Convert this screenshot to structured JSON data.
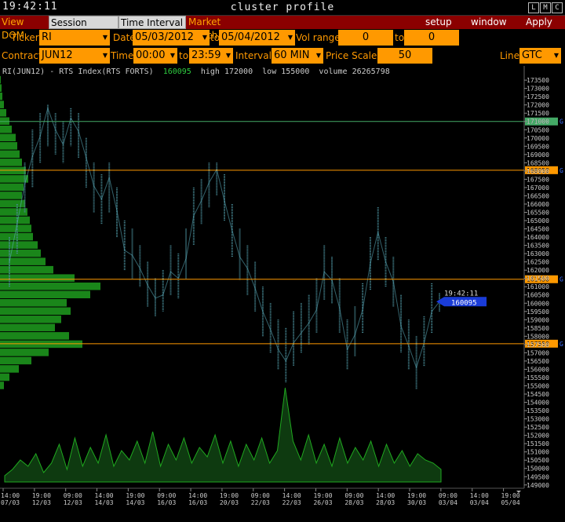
{
  "window": {
    "clock": "19:42:11",
    "title": "cluster profile",
    "buttons": [
      "L",
      "M",
      "C"
    ]
  },
  "menubar": {
    "view_dom": "View DOM",
    "session_hours": "Session Hours",
    "time_interval": "Time Interval",
    "market_watch": "Market Watch",
    "setup": "setup",
    "window": "window",
    "apply": "Apply"
  },
  "controls": {
    "ticker_label": "Ticker",
    "ticker": "RI",
    "date_label": "Date",
    "date_from": "05/03/2012",
    "to_label": "to",
    "date_to": "05/04/2012",
    "vol_range_label": "Vol range",
    "vol_from": "0",
    "vol_to": "0",
    "contract_label": "Contract",
    "contract": "JUN12",
    "time_label": "Time",
    "time_from": "00:00",
    "time_to": "23:59",
    "interval_label": "Interval",
    "interval": "60 MIN",
    "price_scale_label": "Price Scale",
    "price_scale": "50",
    "line_label": "Line",
    "line": "GTC"
  },
  "info": {
    "instrument": "RI(JUN12) - RTS Index(RTS FORTS)",
    "last": "160095",
    "high": "high 172000",
    "low": "low 155000",
    "volume": "volume 26265798"
  },
  "chart_data": {
    "type": "line",
    "y_range": [
      148800,
      173600
    ],
    "y_step": 500,
    "y_ticks_first": 149000,
    "y_ticks_last": 173500,
    "levels": [
      {
        "value": 171000,
        "label": "171000",
        "color": "#44aa66",
        "marker": "G"
      },
      {
        "value": 168050,
        "label": "168050",
        "color": "#ff9900",
        "marker": "G"
      },
      {
        "value": 161450,
        "label": "161450",
        "color": "#ff9900",
        "marker": "G"
      },
      {
        "value": 157550,
        "label": "157550",
        "color": "#ff9900",
        "marker": "G"
      }
    ],
    "current": {
      "time": "19:42:11",
      "value": 160095
    },
    "x_ticks": [
      {
        "t": "14:00",
        "d": "07/03"
      },
      {
        "t": "19:00",
        "d": "12/03"
      },
      {
        "t": "09:00",
        "d": "12/03"
      },
      {
        "t": "14:00",
        "d": "14/03"
      },
      {
        "t": "19:00",
        "d": "14/03"
      },
      {
        "t": "09:00",
        "d": "16/03"
      },
      {
        "t": "14:00",
        "d": "16/03"
      },
      {
        "t": "19:00",
        "d": "20/03"
      },
      {
        "t": "09:00",
        "d": "22/03"
      },
      {
        "t": "14:00",
        "d": "22/03"
      },
      {
        "t": "19:00",
        "d": "26/03"
      },
      {
        "t": "09:00",
        "d": "28/03"
      },
      {
        "t": "14:00",
        "d": "28/03"
      },
      {
        "t": "19:00",
        "d": "30/03"
      },
      {
        "t": "09:00",
        "d": "03/04"
      },
      {
        "t": "14:00",
        "d": "03/04"
      },
      {
        "t": "19:00",
        "d": "05/04"
      }
    ],
    "price_path": [
      162500,
      164800,
      167200,
      168900,
      170100,
      171800,
      170500,
      169600,
      171200,
      170400,
      168800,
      167100,
      166300,
      167600,
      165600,
      163200,
      162900,
      162100,
      161100,
      160300,
      160500,
      161900,
      161500,
      162700,
      165300,
      166200,
      167300,
      168100,
      166200,
      164400,
      162800,
      162100,
      160900,
      159500,
      158400,
      157200,
      156500,
      157600,
      158200,
      158800,
      159600,
      161900,
      161400,
      159700,
      157200,
      158100,
      159600,
      162400,
      164300,
      162500,
      161300,
      158600,
      157400,
      156100,
      157600,
      159500,
      160095
    ],
    "price_ranges": [
      [
        161000,
        164000
      ],
      [
        163000,
        166000
      ],
      [
        165500,
        168500
      ],
      [
        167000,
        170500
      ],
      [
        168500,
        171500
      ],
      [
        169500,
        172000
      ],
      [
        169000,
        171500
      ],
      [
        168500,
        171000
      ],
      [
        169500,
        171800
      ],
      [
        168800,
        171500
      ],
      [
        167000,
        170000
      ],
      [
        165500,
        168500
      ],
      [
        164800,
        167800
      ],
      [
        165500,
        168500
      ],
      [
        164000,
        167000
      ],
      [
        162000,
        165000
      ],
      [
        161500,
        164500
      ],
      [
        161000,
        163500
      ],
      [
        159800,
        162500
      ],
      [
        159200,
        161500
      ],
      [
        159500,
        162000
      ],
      [
        160500,
        163500
      ],
      [
        160300,
        163000
      ],
      [
        161500,
        164500
      ],
      [
        163500,
        167000
      ],
      [
        164800,
        167500
      ],
      [
        165800,
        168500
      ],
      [
        166500,
        168500
      ],
      [
        165000,
        167800
      ],
      [
        162800,
        166000
      ],
      [
        161400,
        164500
      ],
      [
        160500,
        163500
      ],
      [
        159500,
        162500
      ],
      [
        158000,
        161000
      ],
      [
        157000,
        160000
      ],
      [
        156000,
        159000
      ],
      [
        155200,
        158500
      ],
      [
        156200,
        159500
      ],
      [
        157000,
        160000
      ],
      [
        157500,
        160500
      ],
      [
        158200,
        161500
      ],
      [
        160200,
        163500
      ],
      [
        160000,
        162800
      ],
      [
        158200,
        161500
      ],
      [
        156000,
        159000
      ],
      [
        156800,
        159800
      ],
      [
        158200,
        161200
      ],
      [
        160800,
        164000
      ],
      [
        162600,
        165800
      ],
      [
        161000,
        164000
      ],
      [
        159800,
        162800
      ],
      [
        157000,
        160500
      ],
      [
        156000,
        159000
      ],
      [
        154800,
        158000
      ],
      [
        156200,
        159200
      ],
      [
        158200,
        161200
      ],
      [
        159500,
        160600
      ]
    ],
    "volume": [
      2,
      4,
      7,
      5,
      9,
      3,
      6,
      12,
      4,
      14,
      5,
      11,
      6,
      15,
      5,
      10,
      7,
      13,
      6,
      16,
      5,
      12,
      7,
      14,
      6,
      11,
      8,
      15,
      6,
      13,
      5,
      12,
      7,
      14,
      6,
      10,
      5,
      13,
      7,
      15,
      6,
      12,
      5,
      14,
      6,
      11,
      7,
      13,
      5,
      12,
      6,
      10,
      5,
      9,
      7,
      6,
      4
    ],
    "volume_spike": {
      "index": 36,
      "value": 30
    },
    "profile": [
      [
        173500,
        1
      ],
      [
        173000,
        2
      ],
      [
        172500,
        3
      ],
      [
        172000,
        5
      ],
      [
        171500,
        8
      ],
      [
        171000,
        12
      ],
      [
        170500,
        15
      ],
      [
        170000,
        20
      ],
      [
        169500,
        22
      ],
      [
        169000,
        25
      ],
      [
        168500,
        28
      ],
      [
        168000,
        33
      ],
      [
        167500,
        36
      ],
      [
        167000,
        30
      ],
      [
        166500,
        28
      ],
      [
        166000,
        32
      ],
      [
        165500,
        35
      ],
      [
        165000,
        38
      ],
      [
        164500,
        40
      ],
      [
        164000,
        42
      ],
      [
        163500,
        48
      ],
      [
        163000,
        52
      ],
      [
        162500,
        58
      ],
      [
        162000,
        68
      ],
      [
        161500,
        95
      ],
      [
        161000,
        128
      ],
      [
        160500,
        115
      ],
      [
        160000,
        85
      ],
      [
        159500,
        90
      ],
      [
        159000,
        78
      ],
      [
        158500,
        70
      ],
      [
        158000,
        88
      ],
      [
        157500,
        105
      ],
      [
        157000,
        62
      ],
      [
        156500,
        40
      ],
      [
        156000,
        24
      ],
      [
        155500,
        12
      ],
      [
        155000,
        5
      ]
    ],
    "vol_axis": {
      "value": 0
    }
  }
}
